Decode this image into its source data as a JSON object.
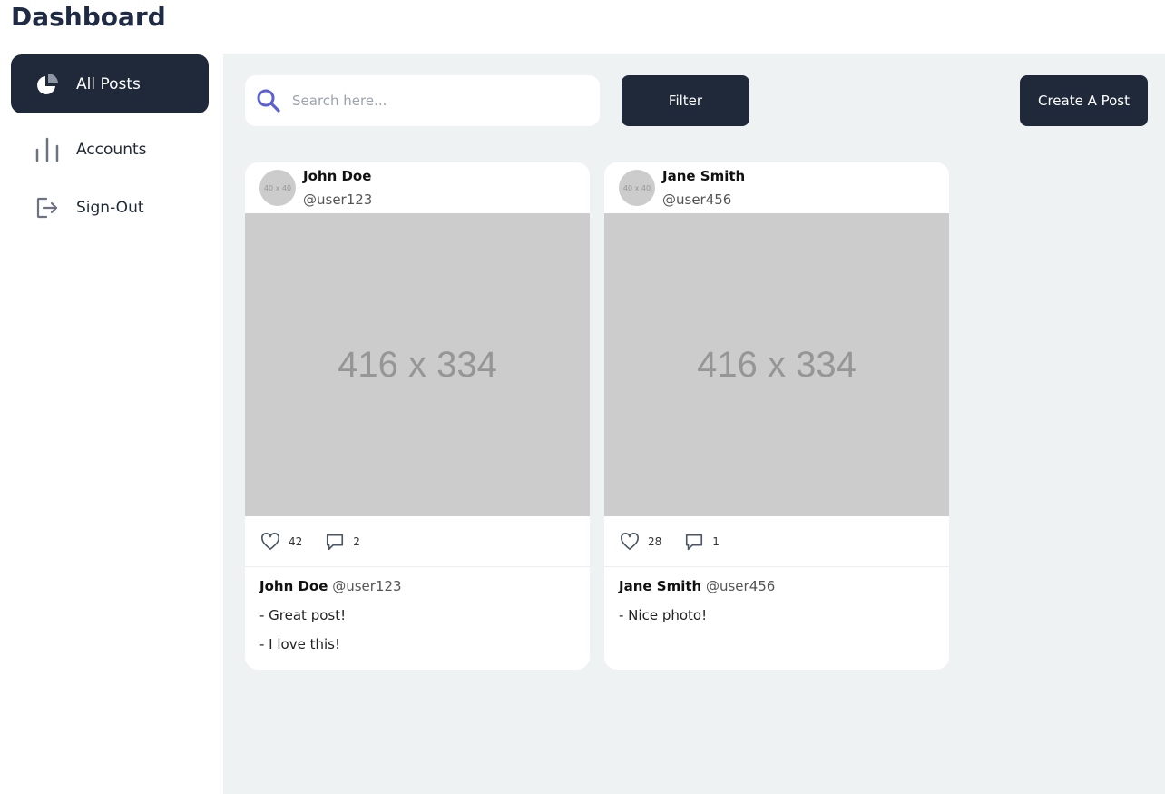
{
  "app": {
    "title": "Dashboard"
  },
  "sidebar": {
    "items": [
      {
        "label": "All Posts",
        "icon": "pie-chart-icon",
        "active": true
      },
      {
        "label": "Accounts",
        "icon": "bar-chart-icon",
        "active": false
      },
      {
        "label": "Sign-Out",
        "icon": "sign-out-icon",
        "active": false
      }
    ]
  },
  "toolbar": {
    "search_placeholder": "Search here...",
    "search_value": "",
    "filter_label": "Filter",
    "create_label": "Create A Post"
  },
  "posts": [
    {
      "author": "John Doe",
      "handle": "@user123",
      "avatar_text": "40 x 40",
      "image_text": "416 x 334",
      "likes": "42",
      "comments_count": "2",
      "comment_author": "John Doe",
      "comment_handle": "@user123",
      "comments": [
        "- Great post!",
        "- I love this!"
      ]
    },
    {
      "author": "Jane Smith",
      "handle": "@user456",
      "avatar_text": "40 x 40",
      "image_text": "416 x 334",
      "likes": "28",
      "comments_count": "1",
      "comment_author": "Jane Smith",
      "comment_handle": "@user456",
      "comments": [
        "- Nice photo!"
      ]
    }
  ],
  "colors": {
    "dark": "#1f2939",
    "title": "#1f2a44",
    "accent": "#5b5fd6",
    "background": "#eef2f3",
    "placeholder_gray": "#cccccc"
  }
}
